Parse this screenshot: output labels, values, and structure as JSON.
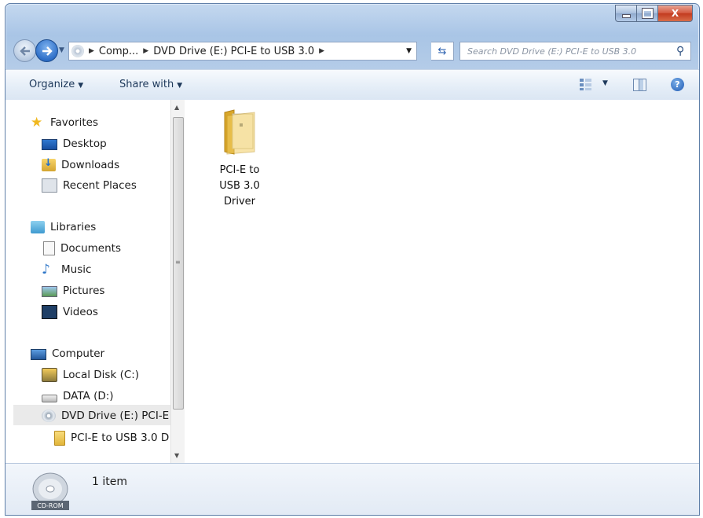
{
  "window": {
    "caption_buttons": {
      "minimize": "—",
      "maximize": "□",
      "close": "X"
    }
  },
  "address_bar": {
    "segments": [
      "Comp...",
      "DVD Drive (E:) PCI-E to USB 3.0"
    ]
  },
  "search": {
    "placeholder": "Search DVD Drive (E:) PCI-E to USB 3.0"
  },
  "toolbar": {
    "organize": "Organize",
    "share_with": "Share with"
  },
  "nav_pane": {
    "favorites": {
      "label": "Favorites",
      "items": [
        "Desktop",
        "Downloads",
        "Recent Places"
      ]
    },
    "libraries": {
      "label": "Libraries",
      "items": [
        "Documents",
        "Music",
        "Pictures",
        "Videos"
      ]
    },
    "computer": {
      "label": "Computer",
      "items": [
        "Local Disk (C:)",
        "DATA (D:)",
        "DVD Drive (E:) PCI-E"
      ]
    },
    "subfolder": "PCI-E to USB 3.0 D"
  },
  "content": {
    "items": [
      {
        "name_lines": [
          "PCI-E to",
          "USB 3.0",
          "Driver"
        ],
        "icon": "folder-icon"
      }
    ]
  },
  "status_bar": {
    "item_count": "1 item",
    "drive_label": "CD-ROM"
  },
  "colors": {
    "accent": "#2e6fc8",
    "selection": "#eaeaea",
    "toolbar": "#e4edf7",
    "folder": "#e2b53a"
  }
}
